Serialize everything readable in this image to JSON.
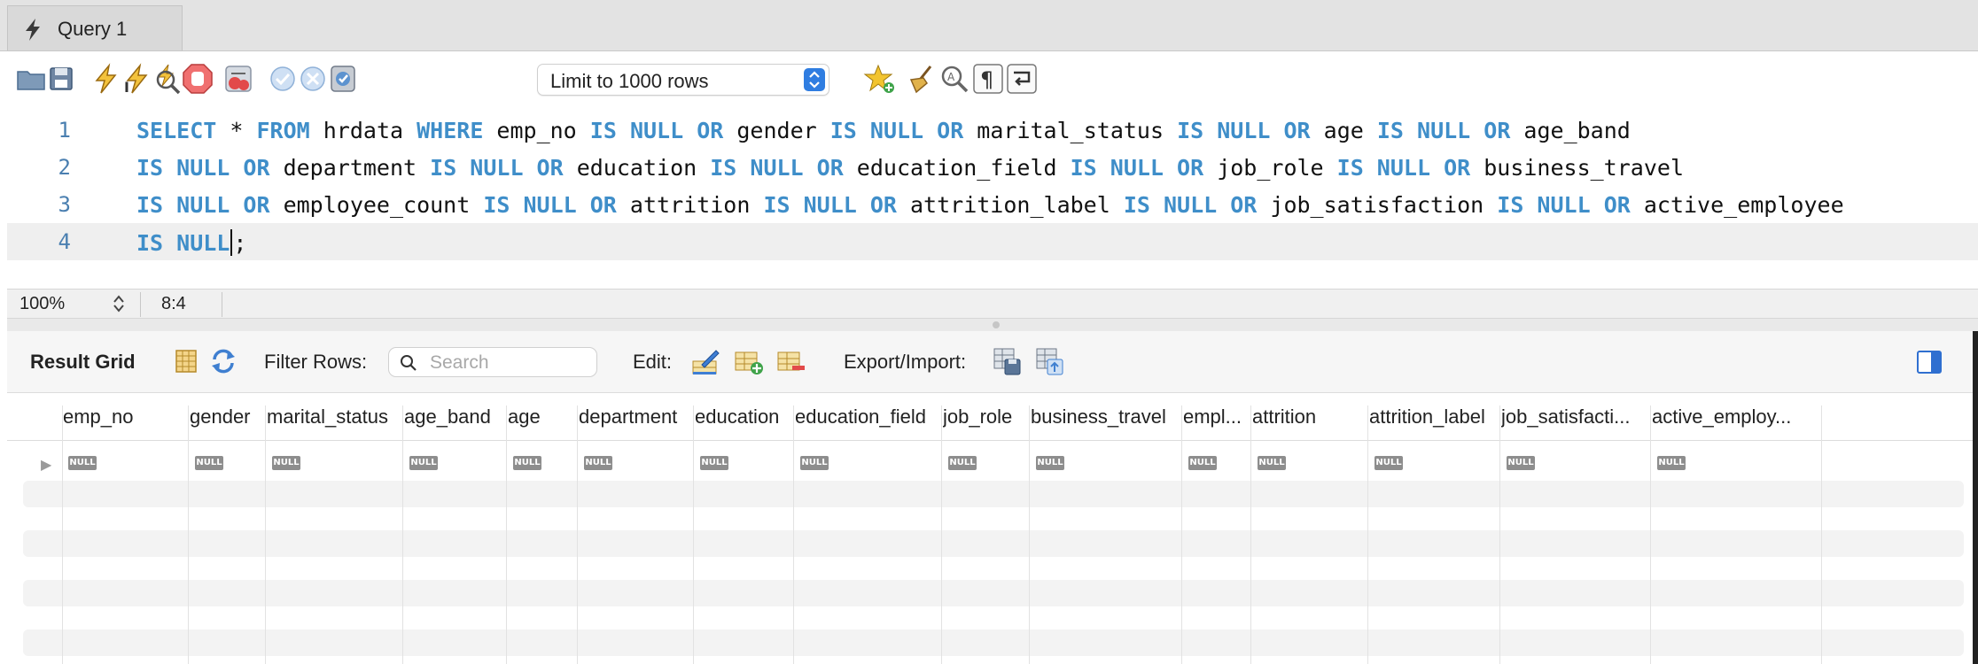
{
  "tab": {
    "title": "Query 1",
    "icon": "lightning-icon"
  },
  "toolbar": {
    "buttons": [
      "open-file",
      "save",
      "execute",
      "execute-current",
      "explain",
      "stop",
      "toggle-continue-on-error",
      "commit",
      "rollback",
      "auto-commit",
      "favorite",
      "beautify",
      "find",
      "invisibles",
      "word-wrap"
    ],
    "limit_select": "Limit to 1000 rows"
  },
  "editor": {
    "lines": [
      {
        "num": "1",
        "tokens": [
          {
            "t": "SELECT",
            "k": 1
          },
          {
            "t": " * ",
            "k": 0
          },
          {
            "t": "FROM",
            "k": 1
          },
          {
            "t": " hrdata ",
            "k": 0
          },
          {
            "t": "WHERE",
            "k": 1
          },
          {
            "t": " emp_no ",
            "k": 0
          },
          {
            "t": "IS NULL OR",
            "k": 1
          },
          {
            "t": " gender ",
            "k": 0
          },
          {
            "t": "IS NULL OR",
            "k": 1
          },
          {
            "t": " marital_status ",
            "k": 0
          },
          {
            "t": "IS NULL OR",
            "k": 1
          },
          {
            "t": " age ",
            "k": 0
          },
          {
            "t": "IS NULL OR",
            "k": 1
          },
          {
            "t": " age_band",
            "k": 0
          }
        ]
      },
      {
        "num": "2",
        "tokens": [
          {
            "t": "IS NULL OR",
            "k": 1
          },
          {
            "t": " department ",
            "k": 0
          },
          {
            "t": "IS NULL OR",
            "k": 1
          },
          {
            "t": " education ",
            "k": 0
          },
          {
            "t": "IS NULL OR",
            "k": 1
          },
          {
            "t": " education_field ",
            "k": 0
          },
          {
            "t": "IS NULL OR",
            "k": 1
          },
          {
            "t": " job_role ",
            "k": 0
          },
          {
            "t": "IS NULL OR",
            "k": 1
          },
          {
            "t": " business_travel",
            "k": 0
          }
        ]
      },
      {
        "num": "3",
        "tokens": [
          {
            "t": "IS NULL OR",
            "k": 1
          },
          {
            "t": " employee_count ",
            "k": 0
          },
          {
            "t": "IS NULL OR",
            "k": 1
          },
          {
            "t": " attrition ",
            "k": 0
          },
          {
            "t": "IS NULL OR",
            "k": 1
          },
          {
            "t": " attrition_label ",
            "k": 0
          },
          {
            "t": "IS NULL OR",
            "k": 1
          },
          {
            "t": " job_satisfaction ",
            "k": 0
          },
          {
            "t": "IS NULL OR",
            "k": 1
          },
          {
            "t": " active_employee",
            "k": 0
          }
        ]
      },
      {
        "num": "4",
        "tokens": [
          {
            "t": "IS NULL",
            "k": 1
          },
          {
            "t": "|",
            "k": 2
          },
          {
            "t": ";",
            "k": 0
          }
        ]
      }
    ]
  },
  "status": {
    "zoom": "100%",
    "cursor_pos": "8:4"
  },
  "result_toolbar": {
    "title": "Result Grid",
    "filter_label": "Filter Rows:",
    "search_placeholder": "Search",
    "edit_label": "Edit:",
    "export_label": "Export/Import:"
  },
  "grid": {
    "columns": [
      "emp_no",
      "gender",
      "marital_status",
      "age_band",
      "age",
      "department",
      "education",
      "education_field",
      "job_role",
      "business_travel",
      "empl...",
      "attrition",
      "attrition_label",
      "job_satisfacti...",
      "active_employ..."
    ],
    "row_marker": "▶",
    "null_label": "NULL"
  }
}
